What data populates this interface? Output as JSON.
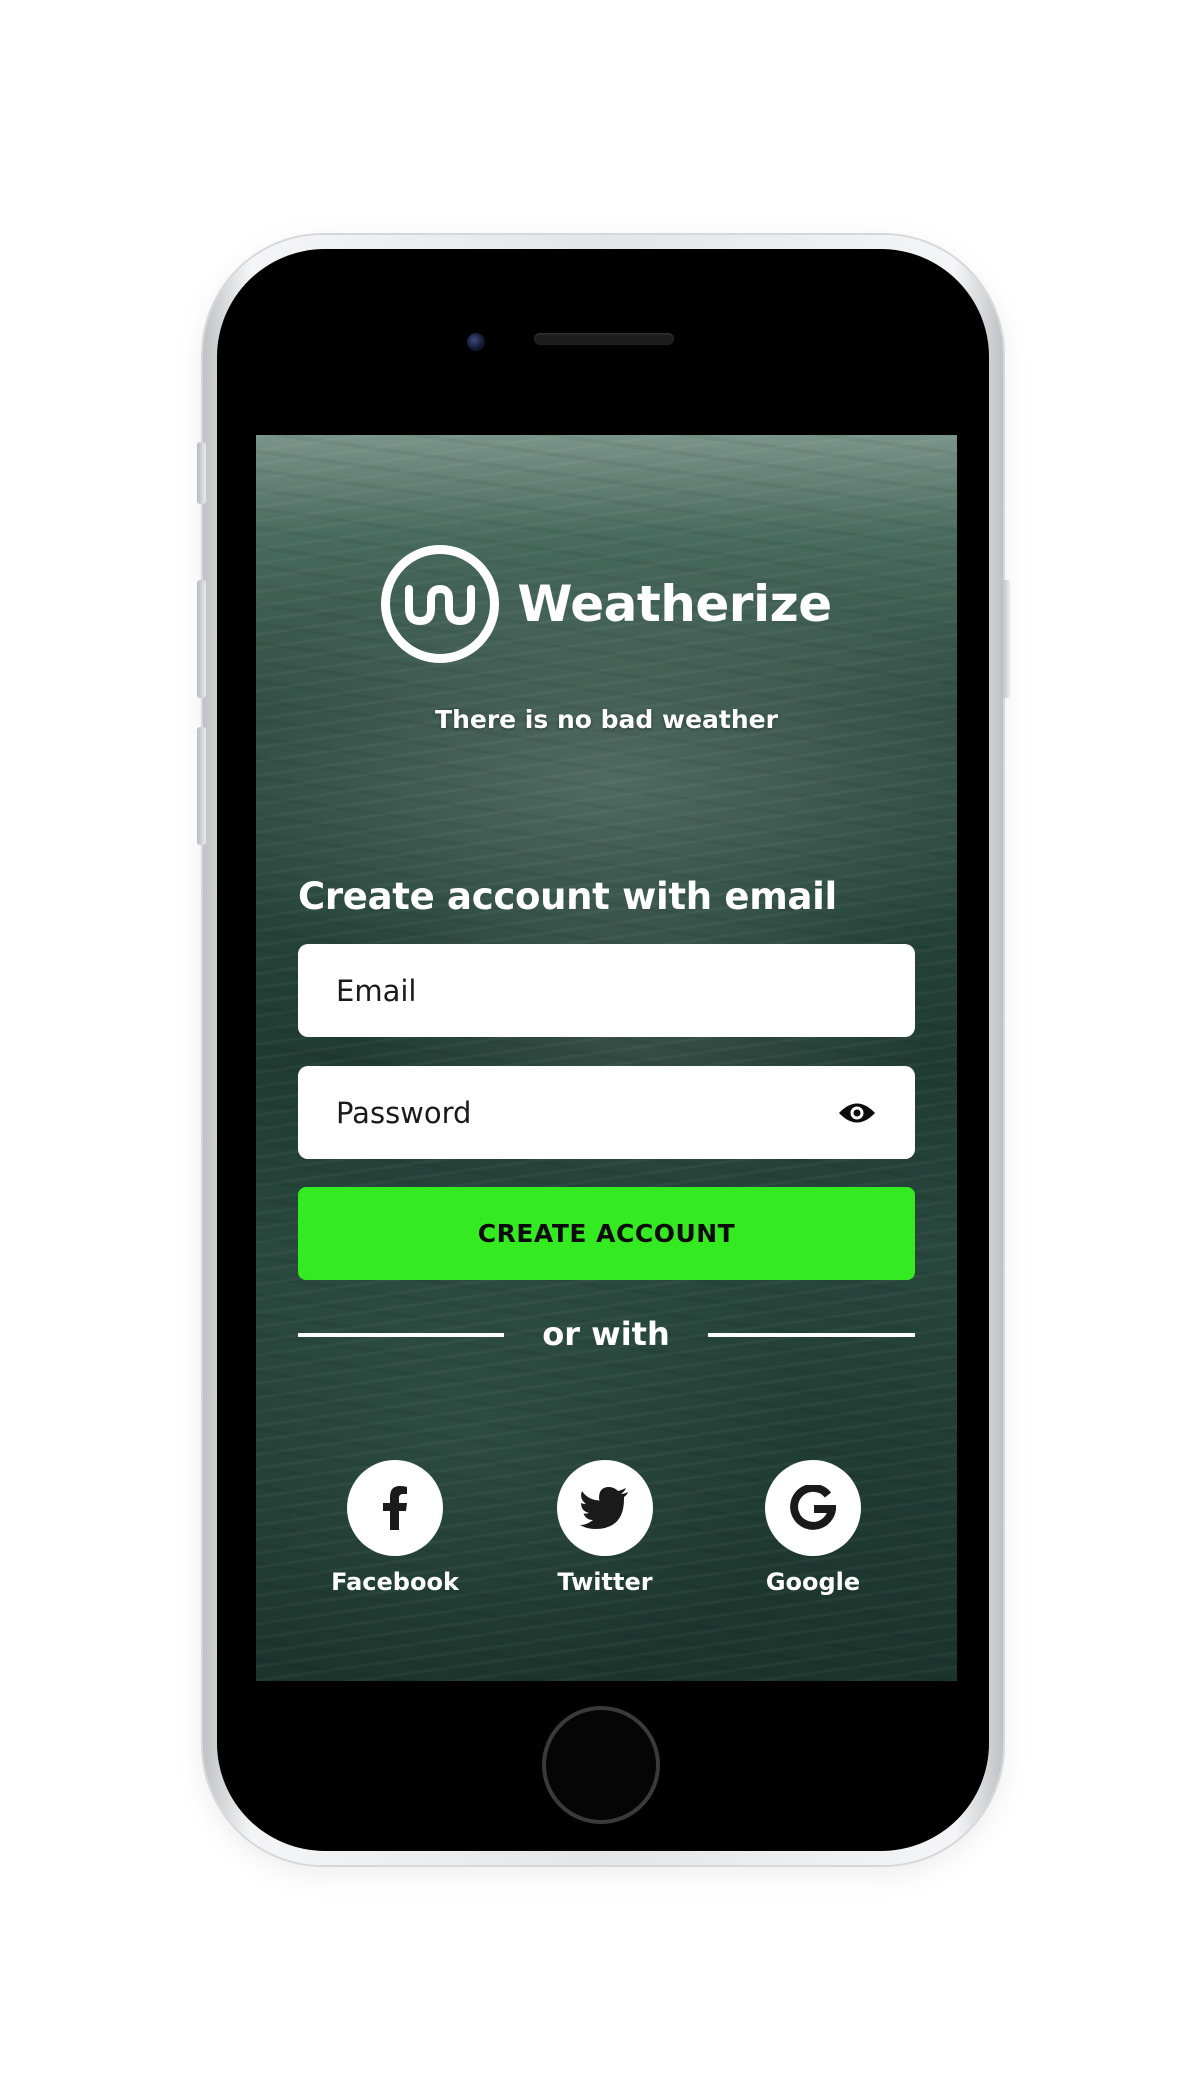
{
  "app": {
    "brand_name": "Weatherize",
    "tagline": "There is no bad weather",
    "logo_icon": "weatherize-logo-icon"
  },
  "form": {
    "heading": "Create account with email",
    "email_placeholder": "Email",
    "password_placeholder": "Password",
    "password_toggle_icon": "eye-icon",
    "submit_label": "CREATE ACCOUNT"
  },
  "social": {
    "divider_label": "or with",
    "providers": [
      {
        "label": "Facebook",
        "icon": "facebook-icon"
      },
      {
        "label": "Twitter",
        "icon": "twitter-icon"
      },
      {
        "label": "Google",
        "icon": "google-icon"
      }
    ]
  },
  "colors": {
    "accent": "#34ea20",
    "text_on_dark": "#ffffff",
    "background_dark": "#1f3b32",
    "field_background": "#ffffff"
  }
}
